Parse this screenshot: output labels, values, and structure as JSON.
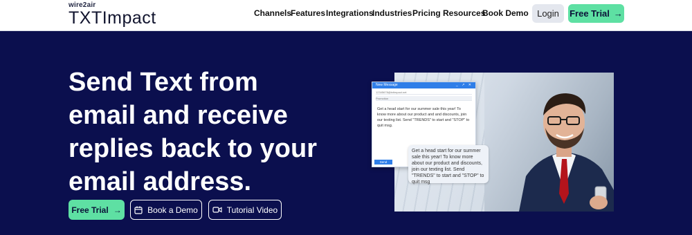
{
  "header": {
    "logo_tag": "wire2air",
    "logo_name": "TXTImpact",
    "nav": [
      "Channels",
      "Features",
      "Integrations",
      "Industries",
      "Pricing",
      "Resources",
      "Book Demo"
    ],
    "login_label": "Login",
    "trial_label": "Free Trial"
  },
  "hero": {
    "headline_lines": [
      "Send Text from",
      "email and receive",
      "replies back to your",
      "email address."
    ],
    "cta_trial": "Free Trial",
    "cta_demo": "Book a Demo",
    "cta_video": "Tutorial Video"
  },
  "illustration": {
    "window_title": "New Message",
    "to_field": "12345678@txtimpact.net",
    "subject_field": "Promotion",
    "email_body": "Get a head start for our summer sale this year! To know more about our product and and discounts, join our texting list. Send \"TRENDS\" to start and \"STOP\" to quit msg.",
    "send_label": "Send",
    "sms_text": "Get a head start for our summer sale this year! To know more about our product and discounts, join our texting list. Send \"TRENDS\" to start and \"STOP\" to quit msg"
  },
  "colors": {
    "background": "#0b0f4e",
    "accent_green": "#5ee0a3",
    "email_blue": "#2f7ee8"
  }
}
